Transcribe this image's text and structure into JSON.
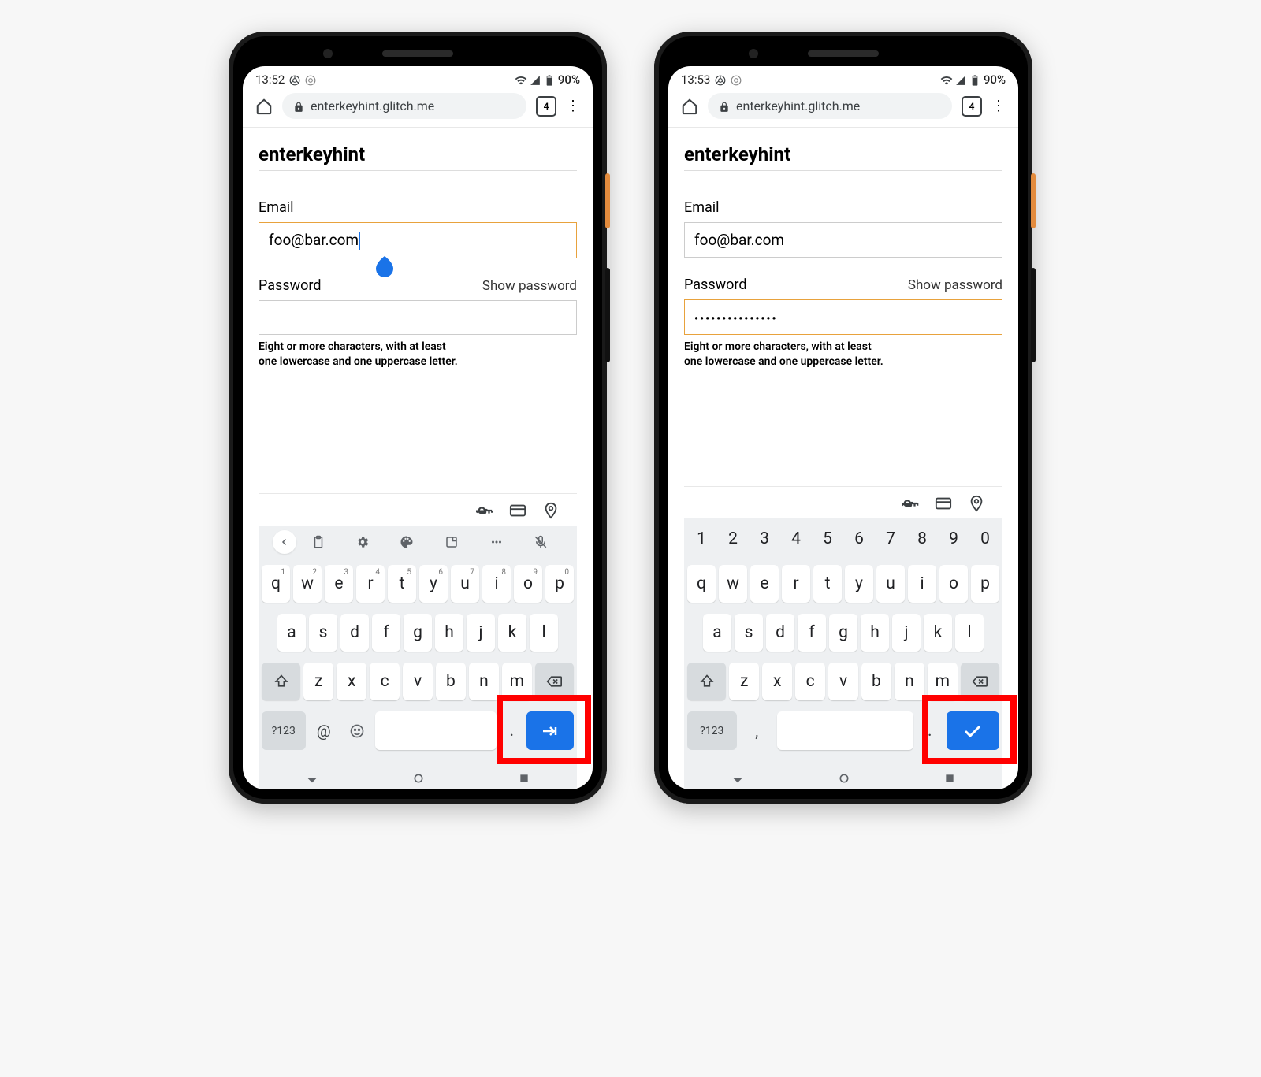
{
  "phones": [
    {
      "status": {
        "time": "13:52",
        "battery": "90%"
      },
      "browser": {
        "url": "enterkeyhint.glitch.me",
        "tab_count": "4"
      },
      "page": {
        "title": "enterkeyhint",
        "email": {
          "label": "Email",
          "value": "foo@bar.com",
          "focused": true
        },
        "password": {
          "label": "Password",
          "show_label": "Show password",
          "value": "",
          "focused": false
        },
        "hint_line1": "Eight or more characters, with at least",
        "hint_line2": "one lowercase and one uppercase letter."
      },
      "keyboard": {
        "mode": "email",
        "toolbar": true,
        "numrow": null,
        "row1": [
          "q",
          "w",
          "e",
          "r",
          "t",
          "y",
          "u",
          "i",
          "o",
          "p"
        ],
        "row1_sup": [
          "1",
          "2",
          "3",
          "4",
          "5",
          "6",
          "7",
          "8",
          "9",
          "0"
        ],
        "row2": [
          "a",
          "s",
          "d",
          "f",
          "g",
          "h",
          "j",
          "k",
          "l"
        ],
        "row3": [
          "z",
          "x",
          "c",
          "v",
          "b",
          "n",
          "m"
        ],
        "sym_label": "?123",
        "extra_key": "@",
        "dot": ".",
        "enter_icon": "next"
      }
    },
    {
      "status": {
        "time": "13:53",
        "battery": "90%"
      },
      "browser": {
        "url": "enterkeyhint.glitch.me",
        "tab_count": "4"
      },
      "page": {
        "title": "enterkeyhint",
        "email": {
          "label": "Email",
          "value": "foo@bar.com",
          "focused": false
        },
        "password": {
          "label": "Password",
          "show_label": "Show password",
          "value": "•••••••••••••••",
          "focused": true
        },
        "hint_line1": "Eight or more characters, with at least",
        "hint_line2": "one lowercase and one uppercase letter."
      },
      "keyboard": {
        "mode": "password",
        "toolbar": false,
        "numrow": [
          "1",
          "2",
          "3",
          "4",
          "5",
          "6",
          "7",
          "8",
          "9",
          "0"
        ],
        "row1": [
          "q",
          "w",
          "e",
          "r",
          "t",
          "y",
          "u",
          "i",
          "o",
          "p"
        ],
        "row1_sup": null,
        "row2": [
          "a",
          "s",
          "d",
          "f",
          "g",
          "h",
          "j",
          "k",
          "l"
        ],
        "row3": [
          "z",
          "x",
          "c",
          "v",
          "b",
          "n",
          "m"
        ],
        "sym_label": "?123",
        "extra_key": ",",
        "dot": ".",
        "enter_icon": "done"
      }
    }
  ]
}
